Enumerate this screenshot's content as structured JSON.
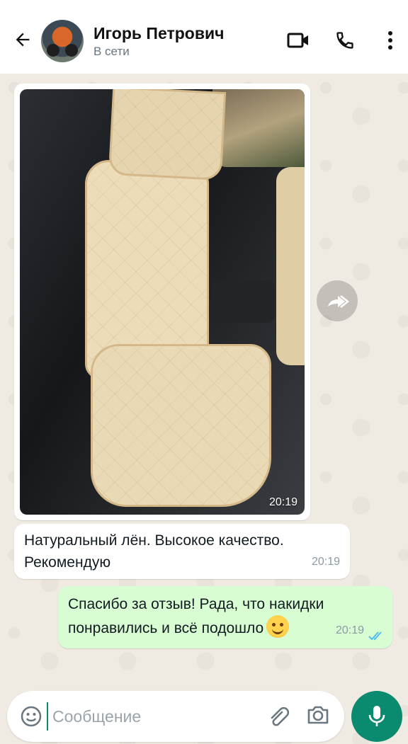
{
  "header": {
    "contact_name": "Игорь Петрович",
    "status": "В сети",
    "icons": [
      "back-arrow-icon",
      "video-call-icon",
      "voice-call-icon",
      "more-menu-icon"
    ]
  },
  "messages": {
    "photo": {
      "time": "20:19"
    },
    "incoming": {
      "text": "Натуральный лён. Высокое качество.\nРекомендую",
      "time": "20:19"
    },
    "outgoing": {
      "text": "Спасибо за отзыв! Рада, что накидки\nпонравились и всё подошло",
      "time": "20:19",
      "status": "read"
    }
  },
  "composer": {
    "placeholder": "Сообщение",
    "value": ""
  },
  "colors": {
    "outgoing_bubble": "#d9fdd3",
    "accent": "#0a8a6e",
    "read_ticks": "#53bdeb"
  }
}
